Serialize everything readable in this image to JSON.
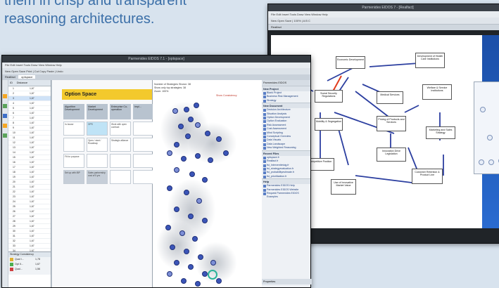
{
  "caption": {
    "line1": "them in crisp and transparent",
    "line2": "reasoning architectures."
  },
  "back_window": {
    "title": "Parmenides EIDOS 7 - [Realfact]",
    "menu": "File  Edit  Insert  Tools  Draw  View  Window  Help",
    "toolbar": "New  Open  Save  |  100%  |  A  B  C",
    "tab": "Realfact",
    "nodes": [
      "Economic Development",
      "Development of Health Care Institutions",
      "Social Security Regulations",
      "Welfare & Service Institutions",
      "Medical Services",
      "Mobility & Segregation",
      "Pricing of Products and Services",
      "Marketing and Sales Strategy",
      "Competitive Position",
      "Innovation Drive Legislation",
      "Customer Retention & Product Line",
      "Use of Innovative Market Value"
    ]
  },
  "front_window": {
    "title": "Parmenides EIDOS 7.1 - [optspace]",
    "menu": "File  Edit  Insert  Tools  Draw  View  Window  Help",
    "toolbar": "New  Open  Save  Print  |  Cut  Copy  Paste  |  Undo",
    "tabs": [
      "Realfact",
      "optspace"
    ],
    "list": {
      "headers": [
        "ID",
        "Distance"
      ],
      "rows": [
        [
          "1",
          "1,67"
        ],
        [
          "2",
          "1,67"
        ],
        [
          "3",
          "1,67"
        ],
        [
          "4",
          "1,67"
        ],
        [
          "5",
          "1,67"
        ],
        [
          "6",
          "1,67"
        ],
        [
          "7",
          "1,67"
        ],
        [
          "8",
          "1,67"
        ],
        [
          "9",
          "1,67"
        ],
        [
          "10",
          "1,67"
        ],
        [
          "11",
          "1,67"
        ],
        [
          "12",
          "1,67"
        ],
        [
          "13",
          "1,67"
        ],
        [
          "14",
          "1,67"
        ],
        [
          "15",
          "1,67"
        ],
        [
          "16",
          "1,67"
        ],
        [
          "17",
          "1,67"
        ],
        [
          "18",
          "1,67"
        ],
        [
          "19",
          "1,67"
        ],
        [
          "20",
          "1,67"
        ],
        [
          "21",
          "1,67"
        ],
        [
          "22",
          "1,67"
        ],
        [
          "23",
          "1,67"
        ],
        [
          "24",
          "1,67"
        ],
        [
          "25",
          "1,67"
        ],
        [
          "26",
          "1,67"
        ],
        [
          "27",
          "1,67"
        ],
        [
          "28",
          "1,67"
        ],
        [
          "29",
          "1,67"
        ],
        [
          "30",
          "1,67"
        ],
        [
          "31",
          "1,67"
        ],
        [
          "32",
          "1,67"
        ],
        [
          "33",
          "1,67"
        ],
        [
          "34",
          "1,67"
        ],
        [
          "35",
          "1,67"
        ],
        [
          "36",
          "1,67"
        ],
        [
          "37",
          "1,67"
        ],
        [
          "38",
          "1,67"
        ]
      ],
      "legend_header": "Strategy    Consistency",
      "legend": [
        {
          "label": "Qual I...",
          "value": "1,78",
          "color": "#e0b030"
        },
        {
          "label": "Opt II...",
          "value": "1,67",
          "color": "#4caf50"
        },
        {
          "label": "Qual...",
          "value": "1,56",
          "color": "#d04040"
        }
      ]
    },
    "option_space": {
      "title": "Option Space",
      "columns": [
        {
          "head": "Algorithm Development",
          "cells": [
            "In-house",
            "",
            "Fit for purpose",
            "Set up with IBP"
          ]
        },
        {
          "head": "Market Development",
          "cells": [
            "OPS",
            "Open / start / Roadmap",
            "",
            "Sales partnership cost of 5 yrs"
          ]
        },
        {
          "head": "Enterprise Co-operation",
          "cells": [
            "Work with open contract",
            "Strategic alliance",
            "",
            ""
          ]
        },
        {
          "head": "Impl...",
          "cells": [
            "",
            "",
            "",
            ""
          ]
        }
      ]
    },
    "scatter": {
      "legend": [
        "Number of Strategies Shown: 38",
        "Show only top strategies: 38",
        "Zoom: 100%"
      ],
      "note": "Show Consistency"
    },
    "side_panel": {
      "header": "Parmenides EIDOS",
      "sections": [
        {
          "title": "New Project",
          "items": [
            "Blank Project",
            "Business Risk Management",
            "Strategy"
          ]
        },
        {
          "title": "New Document",
          "items": [
            "Decision Architecture",
            "Situation Analysis",
            "Option Development",
            "Option Evaluation",
            "Risk Assessment",
            "Cost Assessment",
            "Mind Scripting",
            "Conceptual Overview",
            "Data Visuals",
            "Data Landscape",
            "New Weighted Reasoning"
          ]
        },
        {
          "title": "Recent Files",
          "items": [
            "optspace.fr",
            "Realfact.fr",
            "fst_Interventietoig.fr",
            "fst_strategyevaluation.fr",
            "fst_probabilityestimate.fr",
            "fst_prioritization.fr"
          ]
        },
        {
          "title": "Help",
          "items": [
            "Parmenides EIDOS Help",
            "Parmenides EIDOS Website",
            "Request Parmenides EIDOS Examples"
          ]
        }
      ],
      "footer_tab": "Properties"
    }
  }
}
